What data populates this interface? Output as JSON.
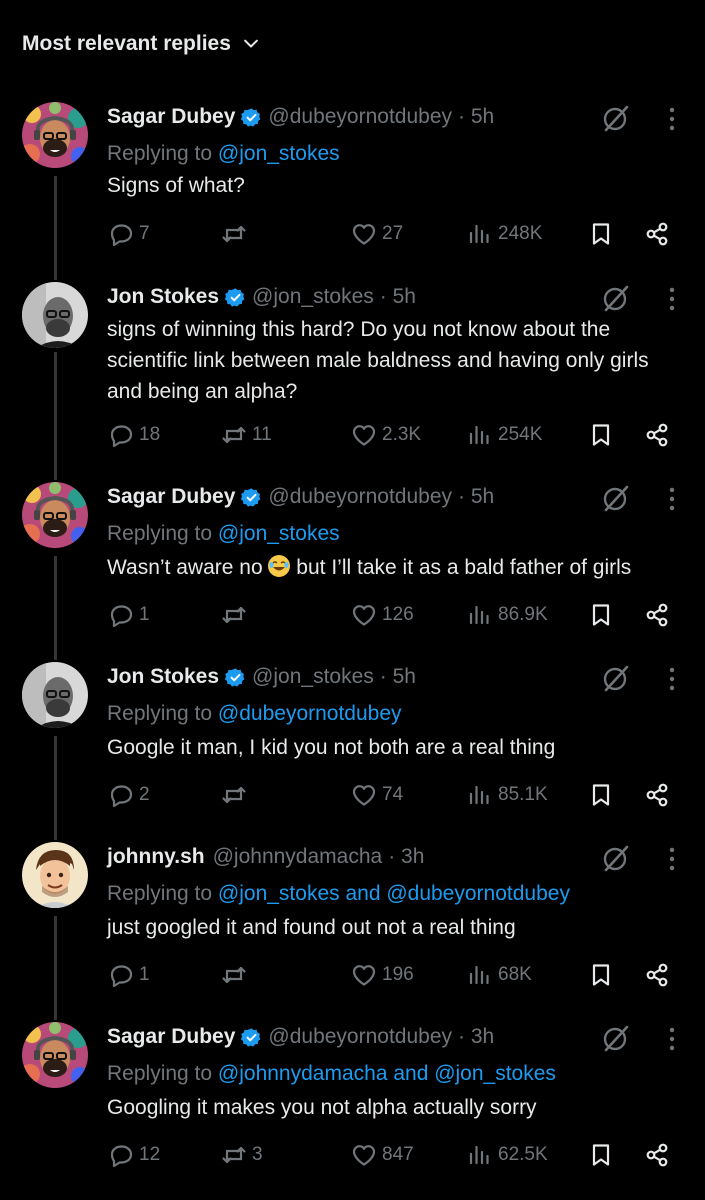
{
  "header": {
    "title": "Most relevant replies"
  },
  "tweets": [
    {
      "author": "Sagar Dubey",
      "verified": true,
      "handle": "@dubeyornotdubey",
      "time": "· 5h",
      "replying_prefix": "Replying to ",
      "replying_links": "@jon_stokes",
      "text": "Signs of what?",
      "replies": "7",
      "reposts": "",
      "likes": "27",
      "views": "248K",
      "avatar": "sagar"
    },
    {
      "author": "Jon Stokes",
      "verified": true,
      "handle": "@jon_stokes",
      "time": "· 5h",
      "replying_prefix": "",
      "replying_links": "",
      "text": "signs of winning this hard? Do you not know about the scientific link between male baldness and having only girls and being an alpha?",
      "replies": "18",
      "reposts": "11",
      "likes": "2.3K",
      "views": "254K",
      "avatar": "jon"
    },
    {
      "author": "Sagar Dubey",
      "verified": true,
      "handle": "@dubeyornotdubey",
      "time": "· 5h",
      "replying_prefix": "Replying to ",
      "replying_links": "@jon_stokes",
      "text_before_emoji": "Wasn’t aware no ",
      "text_after_emoji": " but I’ll take it as a bald father of girls",
      "replies": "1",
      "reposts": "",
      "likes": "126",
      "views": "86.9K",
      "avatar": "sagar"
    },
    {
      "author": "Jon Stokes",
      "verified": true,
      "handle": "@jon_stokes",
      "time": "· 5h",
      "replying_prefix": "Replying to ",
      "replying_links": "@dubeyornotdubey",
      "text": "Google it man, I kid you not both are a real thing",
      "replies": "2",
      "reposts": "",
      "likes": "74",
      "views": "85.1K",
      "avatar": "jon"
    },
    {
      "author": "johnny.sh",
      "verified": false,
      "handle": "@johnnydamacha",
      "time": "· 3h",
      "replying_prefix": "Replying to ",
      "replying_links": "@jon_stokes and @dubeyornotdubey",
      "text": "just googled it and found out not a real thing",
      "replies": "1",
      "reposts": "",
      "likes": "196",
      "views": "68K",
      "avatar": "johnny"
    },
    {
      "author": "Sagar Dubey",
      "verified": true,
      "handle": "@dubeyornotdubey",
      "time": "· 3h",
      "replying_prefix": "Replying to ",
      "replying_links": "@johnnydamacha and @jon_stokes",
      "text": "Googling it makes you not alpha actually sorry",
      "replies": "12",
      "reposts": "3",
      "likes": "847",
      "views": "62.5K",
      "avatar": "sagar"
    }
  ],
  "icons": {
    "reply": "speech-bubble-icon",
    "repost": "repost-arrows-icon",
    "like": "heart-icon",
    "views": "bar-chart-icon",
    "bookmark": "bookmark-icon",
    "share": "share-icon",
    "grok": "grok-slash-circle-icon",
    "more": "vertical-dots-icon",
    "verified": "verified-badge-icon"
  },
  "colors": {
    "background": "#000000",
    "text": "#e7e9ea",
    "muted": "#71767b",
    "link": "#1d9bf0",
    "divider": "#333639"
  }
}
